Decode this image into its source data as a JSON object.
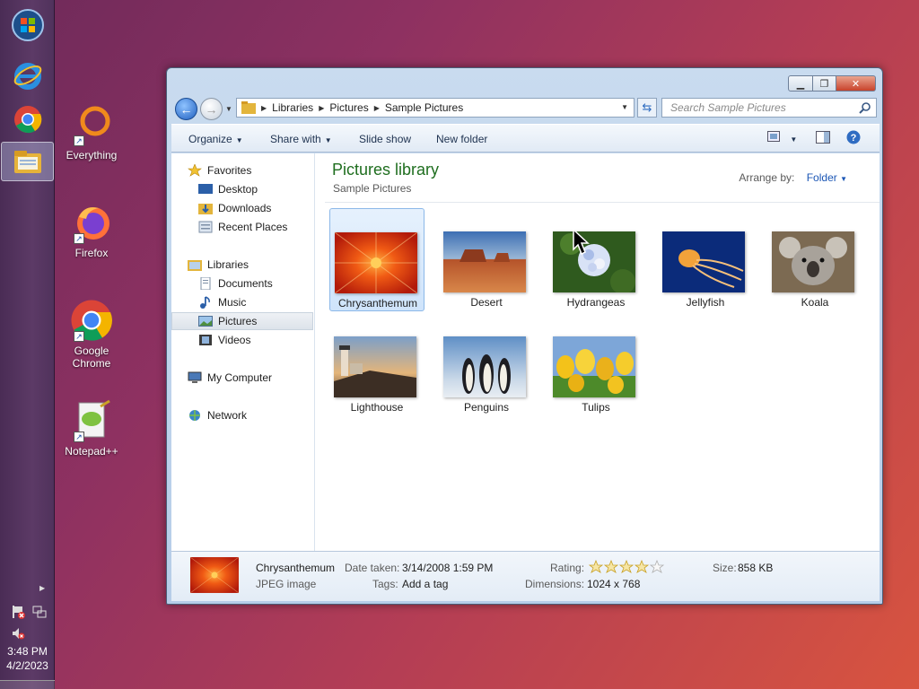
{
  "taskbar": {
    "pinned": [
      {
        "name": "start-orb-icon"
      },
      {
        "name": "internet-explorer-icon"
      },
      {
        "name": "chrome-icon"
      },
      {
        "name": "explorer-icon"
      }
    ],
    "clock": {
      "time": "3:48 PM",
      "date": "4/2/2023"
    }
  },
  "desktop": {
    "icons": [
      {
        "label": "Everything"
      },
      {
        "label": "Firefox"
      },
      {
        "label": "Google Chrome"
      },
      {
        "label": "Notepad++"
      }
    ]
  },
  "window": {
    "address": {
      "crumbs": [
        "Libraries",
        "Pictures",
        "Sample Pictures"
      ]
    },
    "search_placeholder": "Search Sample Pictures",
    "toolbar": {
      "organize": "Organize",
      "share_with": "Share with",
      "slide_show": "Slide show",
      "new_folder": "New folder"
    },
    "nav": {
      "favorites": "Favorites",
      "desktop": "Desktop",
      "downloads": "Downloads",
      "recent_places": "Recent Places",
      "libraries": "Libraries",
      "documents": "Documents",
      "music": "Music",
      "pictures": "Pictures",
      "videos": "Videos",
      "my_computer": "My Computer",
      "network": "Network"
    },
    "library": {
      "title": "Pictures library",
      "subtitle": "Sample Pictures",
      "arrange_label": "Arrange by:",
      "arrange_value": "Folder"
    },
    "files": [
      {
        "name": "Chrysanthemum",
        "selected": true
      },
      {
        "name": "Desert"
      },
      {
        "name": "Hydrangeas"
      },
      {
        "name": "Jellyfish"
      },
      {
        "name": "Koala"
      },
      {
        "name": "Lighthouse"
      },
      {
        "name": "Penguins"
      },
      {
        "name": "Tulips"
      }
    ],
    "details": {
      "name": "Chrysanthemum",
      "type": "JPEG image",
      "date_label": "Date taken:",
      "date_value": "3/14/2008 1:59 PM",
      "tags_label": "Tags:",
      "tags_value": "Add a tag",
      "rating_label": "Rating:",
      "rating_stars": 0,
      "rating_max": 5,
      "dimensions_label": "Dimensions:",
      "dimensions_value": "1024 x 768",
      "size_label": "Size:",
      "size_value": "858 KB"
    }
  }
}
